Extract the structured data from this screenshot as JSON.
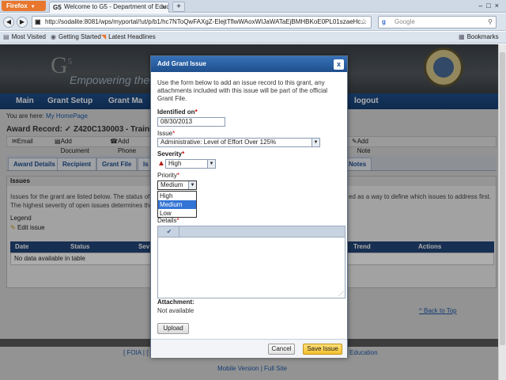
{
  "browser": {
    "menu_label": "Firefox",
    "tab_title": "Welcome to G5 - Department of Educati...",
    "favicon_text": "G5",
    "new_tab": "+",
    "url": "http://sodalite:8081/wps/myportal/!ut/p/b1/hc7NToQwFAXgZ-ElejtTflwWAoxWIJaWATaEjBMHBKoE0PL01szaeHc...",
    "search_placeholder": "Google",
    "bookmarks": [
      "Most Visited",
      "Getting Started",
      "Latest Headlines"
    ],
    "bookmarks_menu": "Bookmarks"
  },
  "site": {
    "logo": "G",
    "logo_sup": "5",
    "tagline": "Empowering the g",
    "nav": [
      "Main",
      "Grant Setup",
      "Grant Ma",
      "logout"
    ],
    "breadcrumb_prefix": "You are here:",
    "breadcrumb_link": "My HomePage",
    "award_title": "Award Record: ✓ Z420C130003 - Training U",
    "toolbar": [
      "Email",
      "Add Document",
      "Add Phone",
      "Add Note"
    ],
    "tabs": [
      "Award Details",
      "Recipient",
      "Grant File",
      "Is",
      "Notes"
    ],
    "issues_header": "Issues",
    "issues_text_1": "Issues for the grant are listed below. The status of th",
    "issues_text_1b": "ed as a way to define which issues to address first.",
    "issues_text_2": "The highest severity of open issues determines the",
    "legend": "Legend",
    "edit_issue": "Edit issue",
    "table_headers": [
      "Date",
      "Status",
      "Sev",
      "Trend",
      "Actions"
    ],
    "table_empty": "No data available in table",
    "back_to_top": "^ Back to Top",
    "footer_link_1": "[ FOIA | [",
    "footer_link_2": "Education",
    "footer_bottom": "Mobile Version | Full Site"
  },
  "dialog": {
    "title": "Add Grant Issue",
    "close": "x",
    "intro": "Use the form below to add an issue record to this grant, any attachments included with this issue will be part of the official Grant File.",
    "identified_on_label": "Identified on",
    "identified_on_value": "08/30/2013",
    "issue_label": "Issue",
    "issue_value": "Administrative: Level of Effort Over 125%",
    "severity_label": "Severity",
    "severity_value": "High",
    "priority_label": "Priority",
    "priority_value": "Medium",
    "priority_options": [
      "High",
      "Medium",
      "Low"
    ],
    "details_label": "Details",
    "attachment_label": "Attachment:",
    "attachment_value": "Not available",
    "upload_button": "Upload",
    "cancel_button": "Cancel",
    "save_button": "Save Issue",
    "required_marker": "*"
  }
}
